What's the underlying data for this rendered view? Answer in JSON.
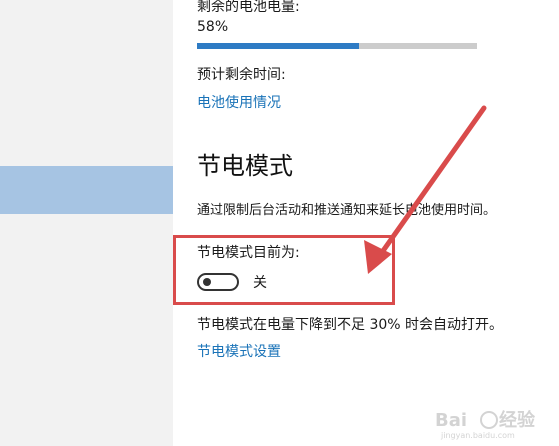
{
  "battery": {
    "remaining_label": "剩余的电池电量:",
    "percent_text": "58%",
    "percent_value": 58,
    "estimated_label": "预计剩余时间:",
    "usage_link": "电池使用情况"
  },
  "saver": {
    "title": "节电模式",
    "description": "通过限制后台活动和推送通知来延长电池使用时间。",
    "status_label": "节电模式目前为:",
    "toggle_state": "关",
    "auto_text": "节电模式在电量下降到不足 30% 时会自动打开。",
    "settings_link": "节电模式设置"
  },
  "colors": {
    "accent": "#2e7bc4",
    "link": "#1a73b8",
    "annotation": "#d94b4b",
    "sidebar_selected": "#a6c4e3"
  }
}
